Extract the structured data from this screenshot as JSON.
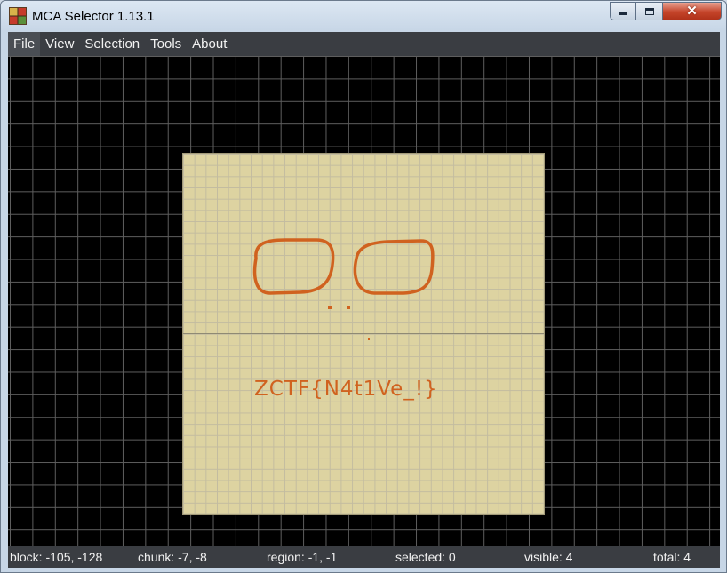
{
  "window": {
    "title": "MCA Selector 1.13.1",
    "controls": {
      "minimize": "minimize",
      "maximize": "maximize",
      "close": "close"
    }
  },
  "menu": {
    "items": [
      {
        "label": "File"
      },
      {
        "label": "View"
      },
      {
        "label": "Selection"
      },
      {
        "label": "Tools"
      },
      {
        "label": "About"
      }
    ]
  },
  "map": {
    "flag_text": "ZCTF{N4t1Ve_!}",
    "colors": {
      "background": "#000000",
      "region_fill": "#ddd3a1",
      "drawing": "#d0621f"
    }
  },
  "status": {
    "block": "block: -105, -128",
    "chunk": "chunk: -7, -8",
    "region": "region: -1, -1",
    "selected": "selected: 0",
    "visible": "visible: 4",
    "total": "total: 4"
  }
}
